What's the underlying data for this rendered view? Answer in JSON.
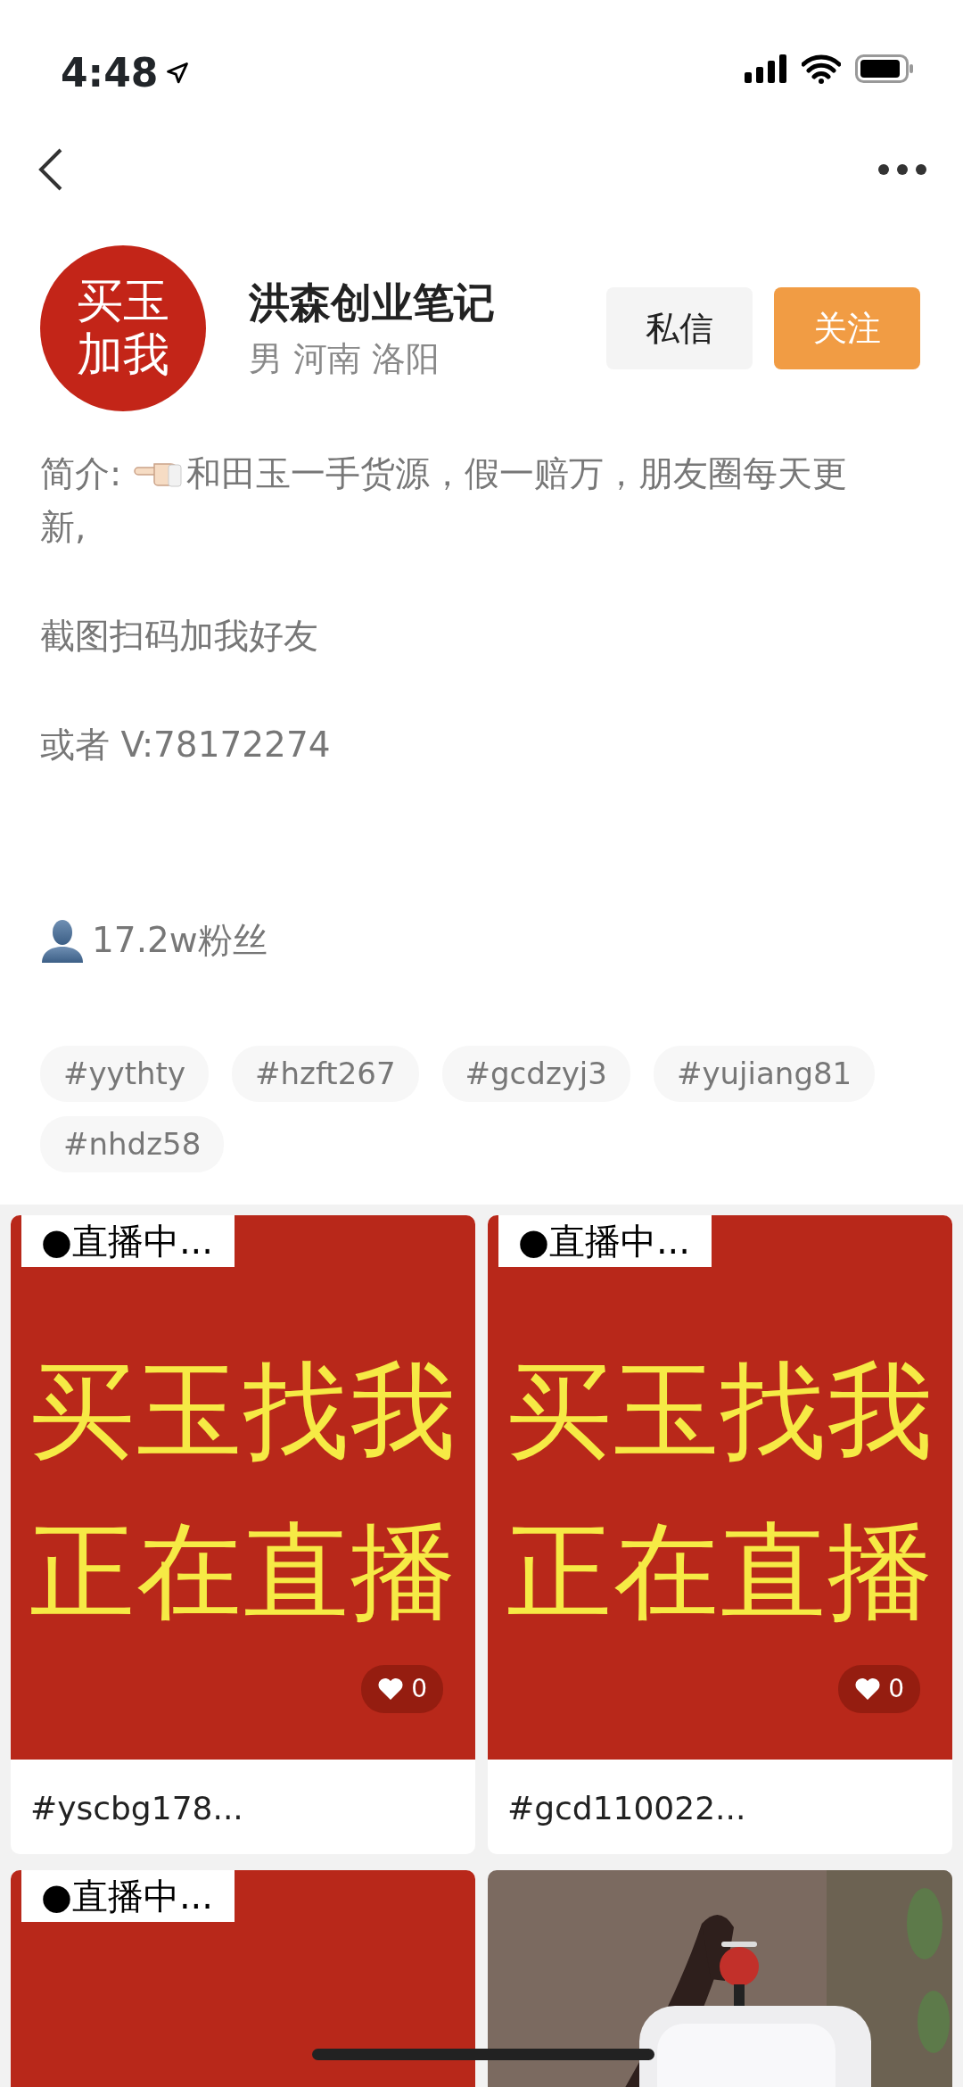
{
  "status_bar": {
    "time": "4:48"
  },
  "profile": {
    "avatar_lines": [
      "买玉",
      "加我"
    ],
    "name": "洪森创业笔记",
    "location": "男 河南 洛阳",
    "buttons": [
      {
        "label": "私信",
        "kind": "secondary"
      },
      {
        "label": "关注",
        "kind": "primary"
      }
    ]
  },
  "bio": {
    "label": "简介:",
    "lines": [
      "和田玉一手货源，假一赔万，朋友圈每天更",
      "新,",
      "截图扫码加我好友",
      "或者 V:78172274"
    ]
  },
  "followers": "17.2w粉丝",
  "tags": [
    "#yythty",
    "#hzft267",
    "#gcdzyj3",
    "#yujiang81",
    "#nhdz58"
  ],
  "posts": [
    {
      "kind": "live",
      "live_label": "●直播中...",
      "cover_lines": [
        "买玉找我",
        "正在直播"
      ],
      "likes": "0",
      "caption": "#yscbg178..."
    },
    {
      "kind": "live",
      "live_label": "●直播中...",
      "cover_lines": [
        "买玉找我",
        "正在直播"
      ],
      "likes": "0",
      "caption": "#gcd110022..."
    },
    {
      "kind": "live",
      "live_label": "●直播中..."
    },
    {
      "kind": "picture"
    }
  ]
}
